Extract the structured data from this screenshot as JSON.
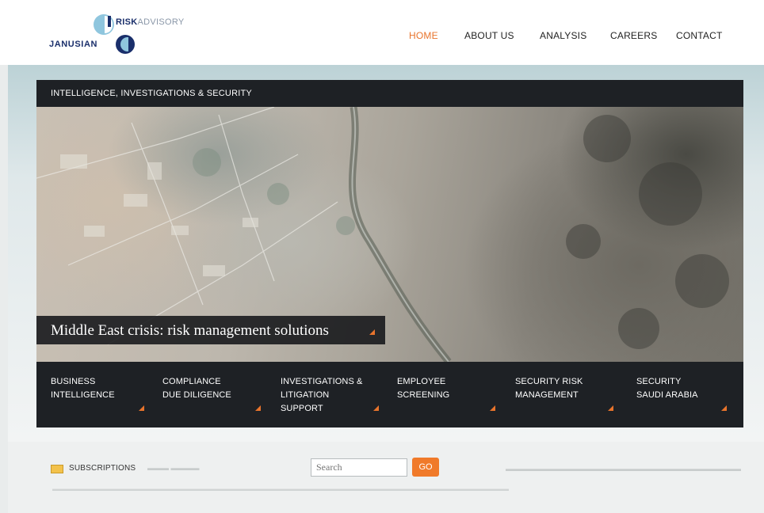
{
  "brand": {
    "risk": "RISK",
    "advisory": "ADVISORY",
    "name": "JANUSIAN"
  },
  "nav": {
    "items": [
      "HOME",
      "ABOUT US",
      "ANALYSIS",
      "CAREERS",
      "CONTACT"
    ],
    "active": "HOME"
  },
  "panel": {
    "title": "INTELLIGENCE, INVESTIGATIONS & SECURITY",
    "hero_caption": "Middle East crisis: risk management solutions"
  },
  "services": [
    "BUSINESS\nINTELLIGENCE",
    "COMPLIANCE\nDUE DILIGENCE",
    "INVESTIGATIONS &\nLITIGATION\nSUPPORT",
    "EMPLOYEE\nSCREENING",
    "SECURITY RISK\nMANAGEMENT",
    "SECURITY\nSAUDI ARABIA"
  ],
  "footer": {
    "subscriptions": "SUBSCRIPTIONS",
    "search_placeholder": "Search",
    "go": "GO"
  },
  "colors": {
    "accent": "#e8742c",
    "dark_panel": "#1e2125",
    "brand_navy": "#1a2f6b",
    "brand_light_blue": "#8fc6de"
  }
}
